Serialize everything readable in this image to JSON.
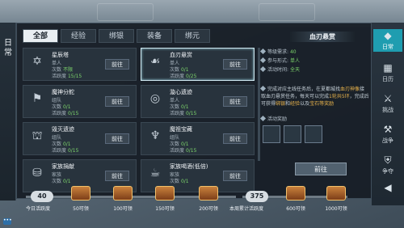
{
  "sidebar": {
    "title": "日常"
  },
  "tabs": [
    {
      "label": "全部"
    },
    {
      "label": "经验"
    },
    {
      "label": "绑银"
    },
    {
      "label": "装备"
    },
    {
      "label": "绑元"
    }
  ],
  "cards": [
    {
      "title": "星辰塔",
      "l1": "单人",
      "l2_prefix": "次数",
      "l2_value": "不限",
      "l3_prefix": "活跃度",
      "l3_value": "15/15",
      "button": "前往",
      "icon": "star-tower-icon"
    },
    {
      "title": "血刃悬赏",
      "l1": "单人",
      "l2_prefix": "次数",
      "l2_value": "0/1",
      "l3_prefix": "活跃度",
      "l3_value": "0/25",
      "button": "前往",
      "icon": "bounty-icon"
    },
    {
      "title": "魔神分舵",
      "l1": "组队",
      "l2_prefix": "次数",
      "l2_value": "0/1",
      "l3_prefix": "活跃度",
      "l3_value": "0/15",
      "button": "前往",
      "icon": "demon-banner-icon"
    },
    {
      "title": "漩心遗迹",
      "l1": "单人",
      "l2_prefix": "次数",
      "l2_value": "0/1",
      "l3_prefix": "活跃度",
      "l3_value": "0/15",
      "button": "前往",
      "icon": "vortex-icon"
    },
    {
      "title": "毁灭遗迹",
      "l1": "组队",
      "l2_prefix": "次数",
      "l2_value": "0/1",
      "l3_prefix": "活跃度",
      "l3_value": "0/15",
      "button": "前往",
      "icon": "ruins-icon"
    },
    {
      "title": "魔祖宝藏",
      "l1": "组队",
      "l2_prefix": "次数",
      "l2_value": "0/1",
      "l3_prefix": "活跃度",
      "l3_value": "0/15",
      "button": "前往",
      "icon": "treasure-icon"
    },
    {
      "title": "家族捐献",
      "l1": "家族",
      "l2_prefix": "次数",
      "l2_value": "0/1",
      "l3_prefix": "",
      "l3_value": "",
      "button": "前往",
      "icon": "family-donate-icon"
    },
    {
      "title": "家族喝酒(低倍)",
      "l1": "家族",
      "l2_prefix": "次数",
      "l2_value": "0/1",
      "l3_prefix": "",
      "l3_value": "",
      "button": "前往",
      "icon": "family-drink-icon"
    }
  ],
  "detail": {
    "title": "血刃悬赏",
    "level_label": "等级需求:",
    "level_value": "40",
    "form_label": "参与形式:",
    "form_value": "单人",
    "time_label": "活动时间:",
    "time_value": "全天",
    "desc_a": "完成对应主线任务后，在夏都城找",
    "desc_b": "血刃神",
    "desc_c": "像",
    "desc_d": "接取血刃悬赏任务，每天可以完成",
    "desc_e": "1轮共5环",
    "desc_f": "，完成后可获得",
    "desc_g": "绑银",
    "desc_h": "和",
    "desc_i": "经验",
    "desc_j": "以及",
    "desc_k": "宝石等奖励",
    "reward_label": "活动奖励",
    "button": "前往"
  },
  "right_tabs": [
    {
      "label": "日常",
      "icon": "daily-icon"
    },
    {
      "label": "日历",
      "icon": "calendar-icon"
    },
    {
      "label": "挑战",
      "icon": "challenge-icon"
    },
    {
      "label": "战争",
      "icon": "war-icon"
    },
    {
      "label": "争夺",
      "icon": "contest-icon"
    }
  ],
  "progress": {
    "today_value": "40",
    "today_label": "今日活跃度",
    "chests": [
      {
        "label": "50可领"
      },
      {
        "label": "100可领"
      },
      {
        "label": "150可领"
      },
      {
        "label": "200可领"
      }
    ],
    "total_value": "375",
    "total_label": "本周累计活跃度",
    "weekly_chests": [
      {
        "label": "600可领"
      },
      {
        "label": "1000可领"
      }
    ]
  }
}
